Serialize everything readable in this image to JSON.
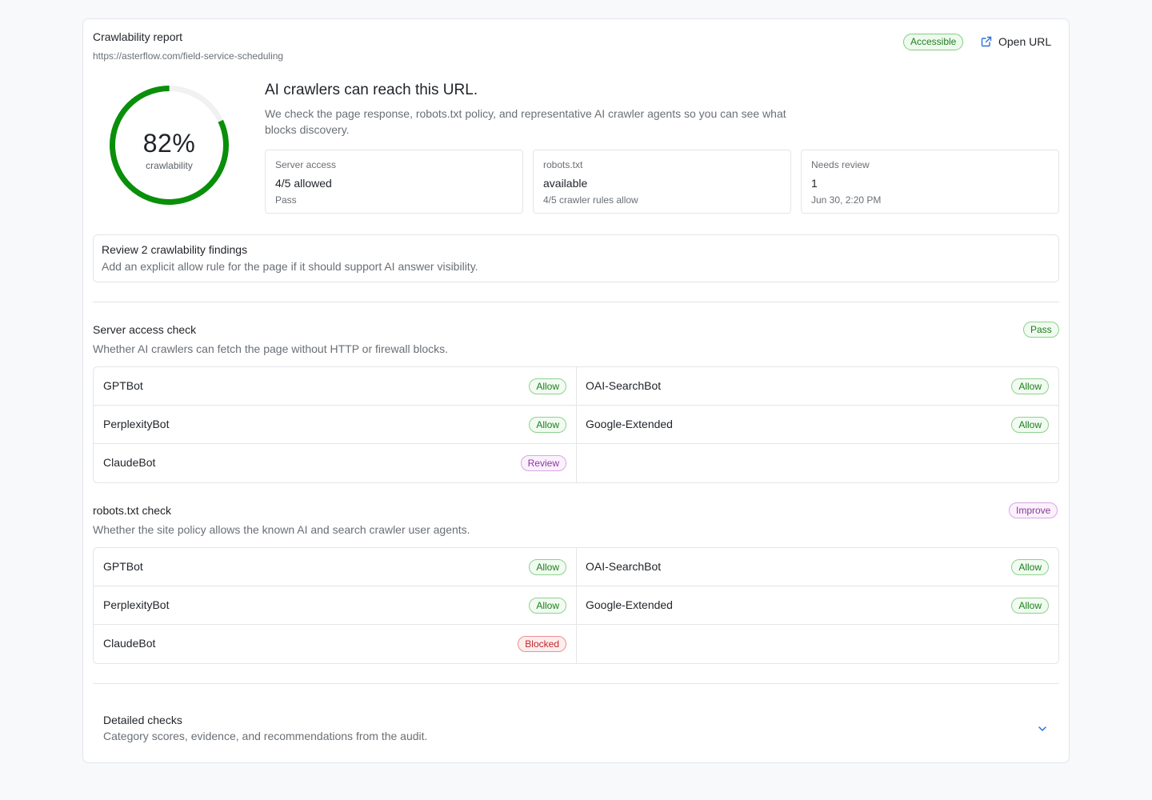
{
  "header": {
    "title": "Crawlability report",
    "url": "https://asterflow.com/field-service-scheduling",
    "status_badge": "Accessible",
    "open_url_label": "Open URL"
  },
  "gauge": {
    "value_text": "82%",
    "label": "crawlability",
    "fraction": 0.82,
    "color": "#0a8f0a",
    "track_color": "#f0f1f3"
  },
  "summary": {
    "headline": "AI crawlers can reach this URL.",
    "description": "We check the page response, robots.txt policy, and representative AI crawler agents so you can see what blocks discovery."
  },
  "stats": [
    {
      "label": "Server access",
      "value": "4/5 allowed",
      "sub": "Pass"
    },
    {
      "label": "robots.txt",
      "value": "available",
      "sub": "4/5 crawler rules allow"
    },
    {
      "label": "Needs review",
      "value": "1",
      "sub": "Jun 30, 2:20 PM"
    }
  ],
  "findings": {
    "title": "Review 2 crawlability findings",
    "text": "Add an explicit allow rule for the page if it should support AI answer visibility."
  },
  "server_check": {
    "title": "Server access check",
    "description": "Whether AI crawlers can fetch the page without HTTP or firewall blocks.",
    "status": "Pass",
    "bots": [
      {
        "name": "GPTBot",
        "status": "Allow"
      },
      {
        "name": "OAI-SearchBot",
        "status": "Allow"
      },
      {
        "name": "PerplexityBot",
        "status": "Allow"
      },
      {
        "name": "Google-Extended",
        "status": "Allow"
      },
      {
        "name": "ClaudeBot",
        "status": "Review"
      }
    ]
  },
  "robots_check": {
    "title": "robots.txt check",
    "description": "Whether the site policy allows the known AI and search crawler user agents.",
    "status": "Improve",
    "bots": [
      {
        "name": "GPTBot",
        "status": "Allow"
      },
      {
        "name": "OAI-SearchBot",
        "status": "Allow"
      },
      {
        "name": "PerplexityBot",
        "status": "Allow"
      },
      {
        "name": "Google-Extended",
        "status": "Allow"
      },
      {
        "name": "ClaudeBot",
        "status": "Blocked"
      }
    ]
  },
  "detailed": {
    "title": "Detailed checks",
    "description": "Category scores, evidence, and recommendations from the audit."
  },
  "colors": {
    "accent": "#2f6fd6",
    "pass": "#1c7e1c",
    "review": "#8a3a98",
    "blocked": "#c0262b"
  },
  "icons": {
    "open_url": "external-link-icon",
    "expand": "chevron-down-icon"
  }
}
